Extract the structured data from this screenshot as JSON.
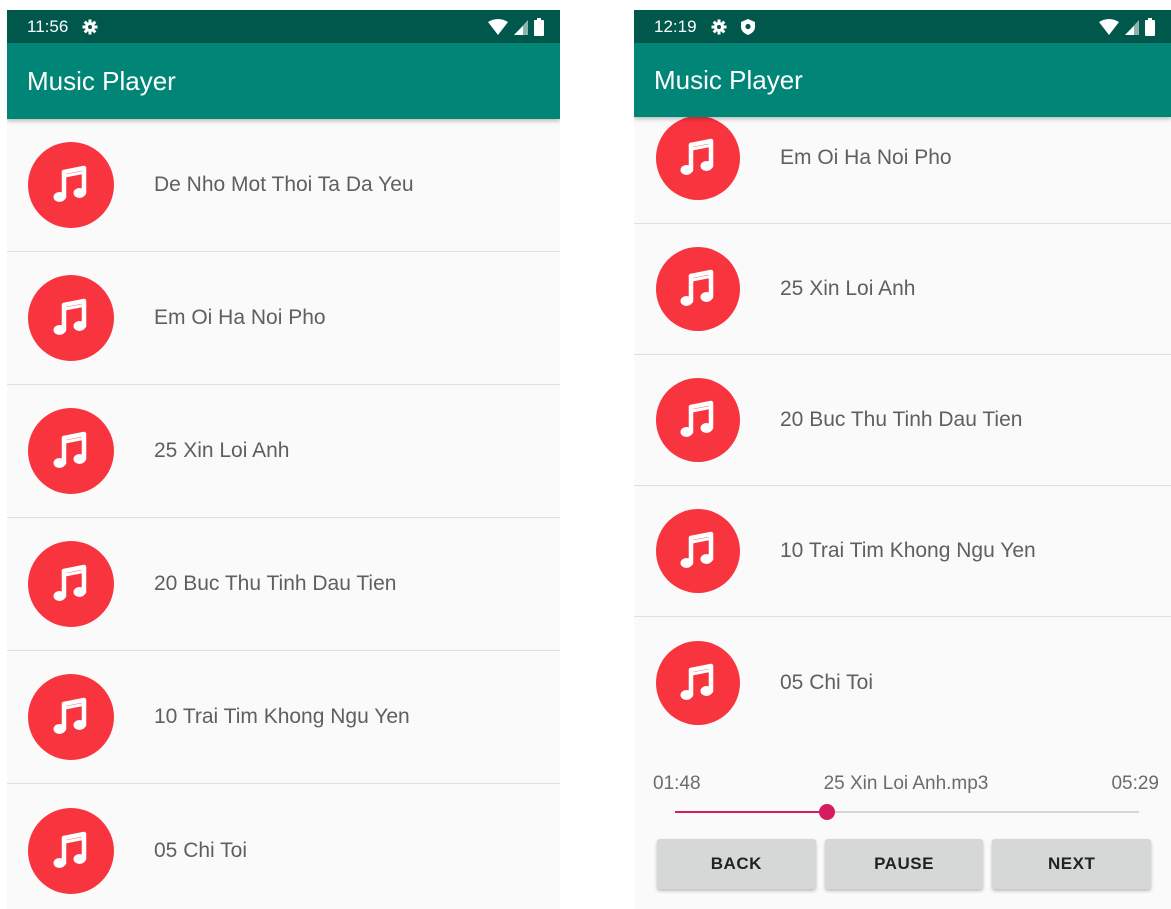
{
  "screens": [
    {
      "status_time": "11:56",
      "app_title": "Music Player",
      "songs": [
        "De Nho Mot Thoi Ta Da Yeu",
        "Em Oi Ha Noi Pho",
        "25 Xin Loi Anh",
        "20 Buc Thu Tinh Dau Tien",
        "10 Trai Tim Khong Ngu Yen",
        "05 Chi Toi"
      ]
    },
    {
      "status_time": "12:19",
      "app_title": "Music Player",
      "songs": [
        "Em Oi Ha Noi Pho",
        "25 Xin Loi Anh",
        "20 Buc Thu Tinh Dau Tien",
        "10 Trai Tim Khong Ngu Yen",
        "05 Chi Toi"
      ],
      "player": {
        "current_time": "01:48",
        "now_playing": "25 Xin Loi Anh.mp3",
        "total_time": "05:29",
        "progress_fraction": 0.328,
        "back_label": "BACK",
        "pause_label": "PAUSE",
        "next_label": "NEXT"
      }
    }
  ],
  "colors": {
    "status_bar": "#00574b",
    "app_bar": "#008577",
    "icon_red": "#f8343f",
    "accent": "#d81b60"
  },
  "icons": {
    "song": "music-note-icon",
    "settings": "gear-icon",
    "shield": "shield-icon",
    "wifi": "wifi-icon",
    "signal": "signal-icon",
    "battery": "battery-icon"
  }
}
